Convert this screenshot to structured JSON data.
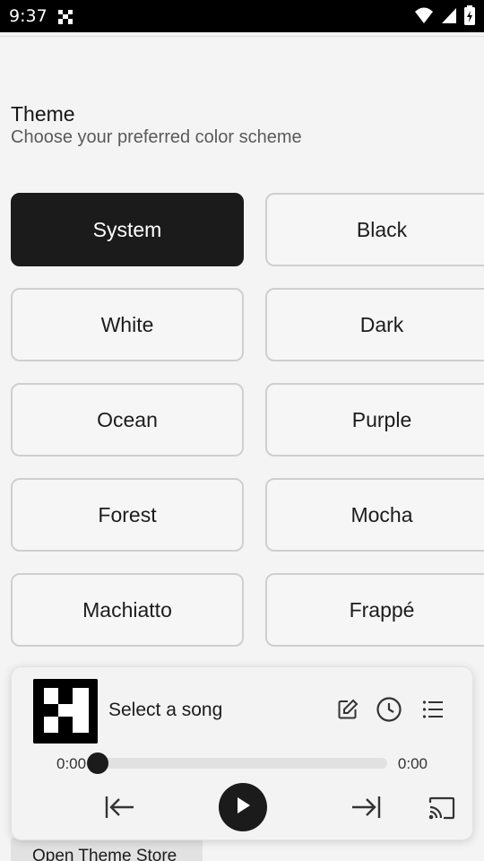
{
  "status_bar": {
    "time": "9:37",
    "icons": [
      "notification-icon",
      "wifi-icon",
      "signal-icon",
      "battery-icon"
    ]
  },
  "theme": {
    "title": "Theme",
    "subtitle": "Choose your preferred color scheme",
    "options": [
      "System",
      "Black",
      "White",
      "Dark",
      "Ocean",
      "Purple",
      "Forest",
      "Mocha",
      "Machiatto",
      "Frappé"
    ],
    "selected": "System"
  },
  "store_button": {
    "label": "Open Theme Store"
  },
  "player": {
    "song_title": "Select a song",
    "time_elapsed": "0:00",
    "time_total": "0:00",
    "progress": 0,
    "icons": [
      "edit-icon",
      "history-icon",
      "queue-icon",
      "previous-icon",
      "play-icon",
      "next-icon",
      "cast-icon"
    ]
  },
  "colors": {
    "selected_bg": "#1b1b1b",
    "background": "#f4f4f4",
    "border": "#cfcfcf"
  }
}
